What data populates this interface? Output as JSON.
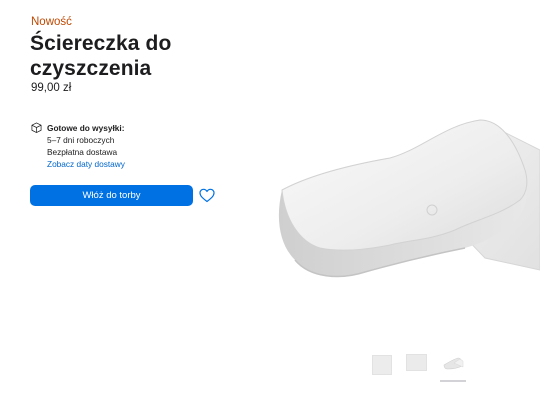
{
  "product": {
    "badge": "Nowość",
    "title": "Ściereczka do czyszczenia",
    "price": "99,00 zł"
  },
  "shipping": {
    "icon": "box-icon",
    "heading": "Gotowe do wysyłki:",
    "time": "5–7 dni roboczych",
    "cost": "Bezpłatna dostawa",
    "link": "Zobacz daty dostawy"
  },
  "actions": {
    "add_to_bag": "Włóż do torby",
    "favorite_icon": "heart-icon"
  },
  "gallery": {
    "thumbnail_count": 3,
    "selected_index": 3
  },
  "colors": {
    "badge": "#bf4800",
    "button": "#0071e3",
    "link": "#0066cc",
    "text": "#1d1d1f"
  }
}
